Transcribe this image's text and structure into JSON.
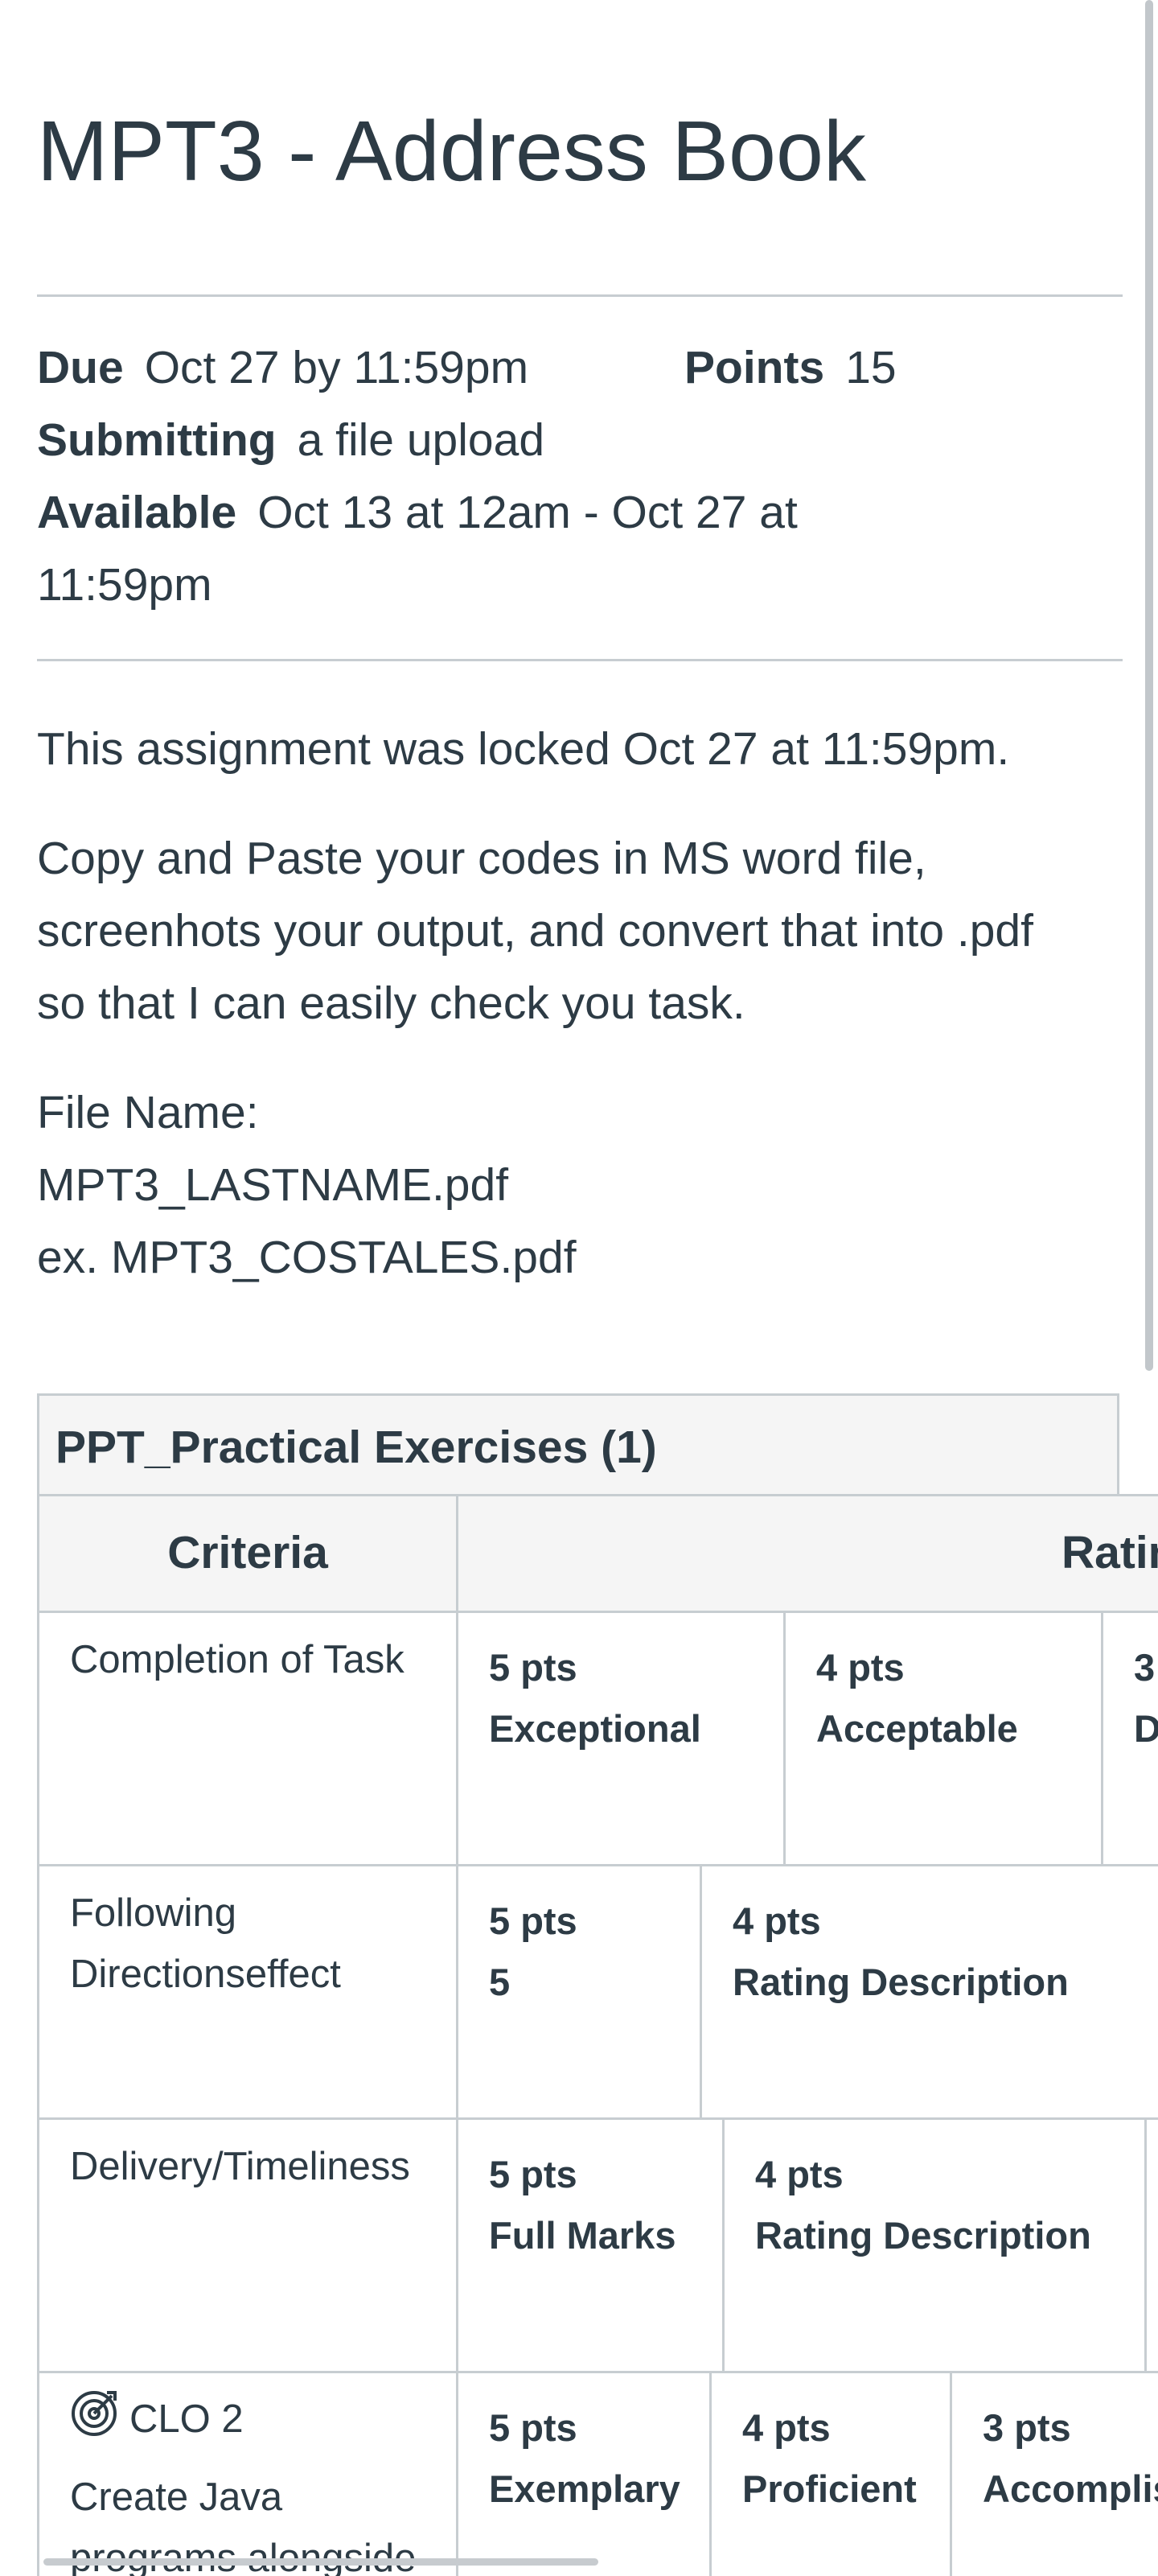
{
  "assignment": {
    "title": "MPT3 - Address Book",
    "due_label": "Due",
    "due_value": "Oct 27 by 11:59pm",
    "points_label": "Points",
    "points_value": "15",
    "submitting_label": "Submitting",
    "submitting_value": "a file upload",
    "available_label": "Available",
    "available_value_line1": "Oct 13 at 12am - Oct 27 at",
    "available_value_line2": "11:59pm"
  },
  "description": {
    "locked_notice": "This assignment was locked Oct 27 at 11:59pm.",
    "instructions_line1": "Copy and Paste your codes in MS word file,",
    "instructions_line2": "screenhots your output, and convert that into .pdf",
    "instructions_line3": "so that I can easily check you task.",
    "file_name_label": "File Name:",
    "file_name_pattern": "MPT3_LASTNAME.pdf",
    "file_name_example": "ex. MPT3_COSTALES.pdf"
  },
  "rubric": {
    "title": "PPT_Practical Exercises (1)",
    "criteria_header": "Criteria",
    "ratings_header": "Ratin",
    "rows": [
      {
        "criterion": "Completion of Task",
        "ratings": [
          {
            "pts": "5 pts",
            "desc": "Exceptional"
          },
          {
            "pts": "4 pts",
            "desc": "Acceptable"
          },
          {
            "pts": "3",
            "desc": "D"
          }
        ]
      },
      {
        "criterion_line1": "Following",
        "criterion_line2": "Directionseffect",
        "ratings": [
          {
            "pts": "5 pts",
            "desc": "5"
          },
          {
            "pts": "4 pts",
            "desc": "Rating Description"
          }
        ]
      },
      {
        "criterion": "Delivery/Timeliness",
        "ratings": [
          {
            "pts": "5 pts",
            "desc": "Full Marks"
          },
          {
            "pts": "4 pts",
            "desc": "Rating Description"
          }
        ]
      },
      {
        "outcome_label": "CLO 2",
        "criterion_line1": "Create Java",
        "criterion_line2": "programs alongside",
        "ratings": [
          {
            "pts": "5 pts",
            "desc": "Exemplary"
          },
          {
            "pts": "4 pts",
            "desc": "Proficient"
          },
          {
            "pts": "3 pts",
            "desc": "Accomplis"
          }
        ]
      }
    ]
  },
  "icons": {
    "outcome": "outcome-target-icon"
  },
  "colors": {
    "text": "#2d3b45",
    "border": "#c7cdd1",
    "header_bg": "#f5f5f5"
  }
}
